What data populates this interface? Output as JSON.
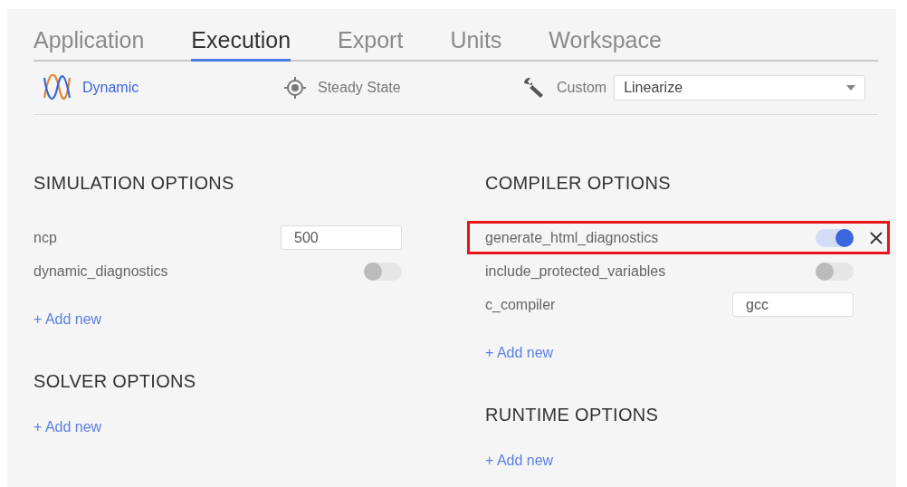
{
  "tabs": [
    {
      "label": "Application",
      "selected": false
    },
    {
      "label": "Execution",
      "selected": true
    },
    {
      "label": "Export",
      "selected": false
    },
    {
      "label": "Units",
      "selected": false
    },
    {
      "label": "Workspace",
      "selected": false
    }
  ],
  "modes": [
    {
      "kind": "dynamic",
      "label": "Dynamic",
      "selected": true
    },
    {
      "kind": "steady",
      "label": "Steady State",
      "selected": false
    },
    {
      "kind": "custom",
      "label": "Custom",
      "selected": false
    }
  ],
  "custom_select": {
    "value": "Linearize"
  },
  "columns": [
    {
      "sections": [
        {
          "title": "SIMULATION OPTIONS",
          "rows": [
            {
              "kind": "input",
              "name": "ncp",
              "value": "500",
              "highlighted": false
            },
            {
              "kind": "toggle",
              "name": "dynamic_diagnostics",
              "on": false,
              "highlighted": false
            }
          ],
          "add_label": "+ Add new"
        },
        {
          "title": "SOLVER OPTIONS",
          "add_label": "+ Add new"
        }
      ]
    },
    {
      "sections": [
        {
          "title": "COMPILER OPTIONS",
          "rows": [
            {
              "kind": "toggle",
              "name": "generate_html_diagnostics",
              "on": true,
              "highlighted": true
            },
            {
              "kind": "toggle",
              "name": "include_protected_variables",
              "on": false,
              "highlighted": false
            },
            {
              "kind": "input",
              "name": "c_compiler",
              "value": "gcc",
              "highlighted": false
            }
          ],
          "add_label": "+ Add new"
        },
        {
          "title": "RUNTIME OPTIONS",
          "add_label": "+ Add new"
        }
      ]
    }
  ]
}
